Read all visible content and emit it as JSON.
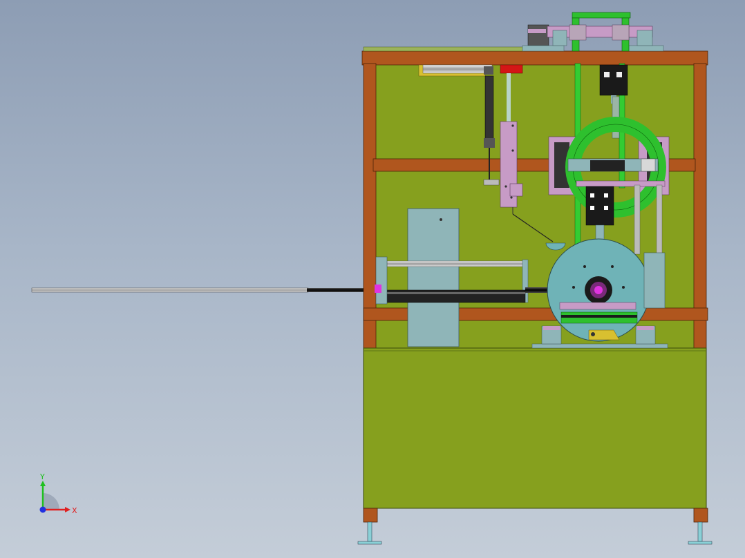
{
  "viewport": {
    "background_top": "#8d9db4",
    "background_bottom": "#c4cdd8"
  },
  "colors": {
    "frame_wood": "#b0561e",
    "panel_green": "#86a01e",
    "cabinet_green": "#86a01e",
    "coil_green": "#2ec02e",
    "rod_green": "#33cc33",
    "disc_teal": "#6fb3b7",
    "bracket_pink": "#c79bc6",
    "tower_grey": "#8fb5b8",
    "steel": "#d8d8d8",
    "black_block": "#1a1a1a",
    "accent_red": "#d41616",
    "accent_magenta": "#e033e0",
    "accent_yellow": "#d8c030"
  },
  "triad": {
    "x_label": "X",
    "y_label": "Y",
    "x_color": "#e02020",
    "y_color": "#20c020",
    "z_color": "#2030e0"
  },
  "icons": {
    "triad": "xyz-triad-icon"
  }
}
